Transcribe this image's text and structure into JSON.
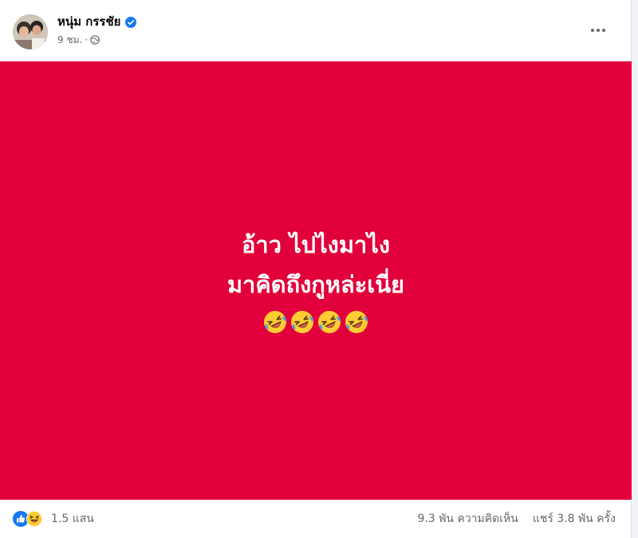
{
  "post": {
    "author": {
      "name": "หนุ่ม กรรชัย",
      "verified": true
    },
    "time": "9 ชม.",
    "meta_separator": "·",
    "privacy_icon": "globe-icon",
    "menu_icon": "more-horizontal-icon",
    "background_color": "#e1003b",
    "text_lines": [
      "อ้าว ไปไงมาไง",
      "มาคิดถึงกูหล่ะเนี่ย"
    ],
    "emojis": [
      "rolling-on-floor-laughing-icon",
      "rolling-on-floor-laughing-icon",
      "rolling-on-floor-laughing-icon",
      "rolling-on-floor-laughing-icon"
    ]
  },
  "footer": {
    "reaction_icons": [
      "like-icon",
      "haha-icon"
    ],
    "reaction_count": "1.5 แสน",
    "comments": "9.3 พัน ความคิดเห็น",
    "shares": "แชร์ 3.8 พัน ครั้ง"
  },
  "colors": {
    "post_background": "#e1003b",
    "verified_blue": "#1877f2",
    "secondary_text": "#65676b"
  }
}
